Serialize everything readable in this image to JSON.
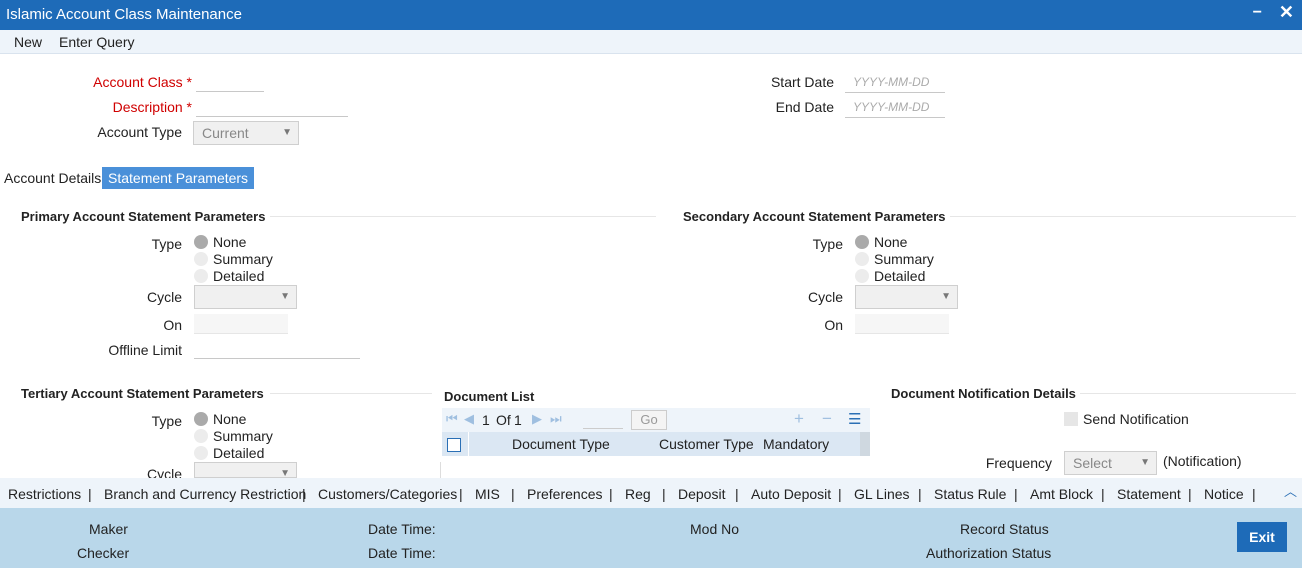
{
  "window": {
    "title": "Islamic Account Class Maintenance",
    "minimize": "−",
    "close": "✕"
  },
  "menu": {
    "new": "New",
    "enter_query": "Enter Query"
  },
  "form": {
    "account_class_label": "Account Class",
    "description_label": "Description",
    "account_type_label": "Account Type",
    "account_type_value": "Current",
    "required_mark": "*",
    "start_date_label": "Start Date",
    "end_date_label": "End Date",
    "date_placeholder": "YYYY-MM-DD"
  },
  "tabs": {
    "account_details": "Account Details",
    "statement_parameters": "Statement Parameters"
  },
  "primary": {
    "heading": "Primary Account Statement Parameters",
    "type_label": "Type",
    "options": [
      "None",
      "Summary",
      "Detailed"
    ],
    "cycle_label": "Cycle",
    "on_label": "On",
    "offline_limit_label": "Offline Limit"
  },
  "secondary": {
    "heading": "Secondary Account Statement Parameters",
    "type_label": "Type",
    "options": [
      "None",
      "Summary",
      "Detailed"
    ],
    "cycle_label": "Cycle",
    "on_label": "On"
  },
  "tertiary": {
    "heading": "Tertiary Account Statement Parameters",
    "type_label": "Type",
    "options": [
      "None",
      "Summary",
      "Detailed"
    ],
    "cycle_label": "Cycle"
  },
  "document_list": {
    "heading": "Document List",
    "page_current": "1",
    "page_of": "Of",
    "page_total": "1",
    "go": "Go",
    "columns": [
      "Document Type",
      "Customer Type",
      "Mandatory"
    ]
  },
  "notification": {
    "heading": "Document Notification Details",
    "send_label": "Send Notification",
    "frequency_label": "Frequency",
    "frequency_value": "Select",
    "suffix": "(Notification)"
  },
  "bottom_nav": [
    "Restrictions",
    "Branch and Currency Restriction",
    "Customers/Categories",
    "MIS",
    "Preferences",
    "Reg",
    "Deposit",
    "Auto Deposit",
    "GL Lines",
    "Status Rule",
    "Amt Block",
    "Statement",
    "Notice"
  ],
  "bottom_nav_separator": "|",
  "footer": {
    "maker": "Maker",
    "checker": "Checker",
    "date_time": "Date Time:",
    "mod_no": "Mod No",
    "record_status": "Record Status",
    "authorization_status": "Authorization Status",
    "exit": "Exit"
  }
}
